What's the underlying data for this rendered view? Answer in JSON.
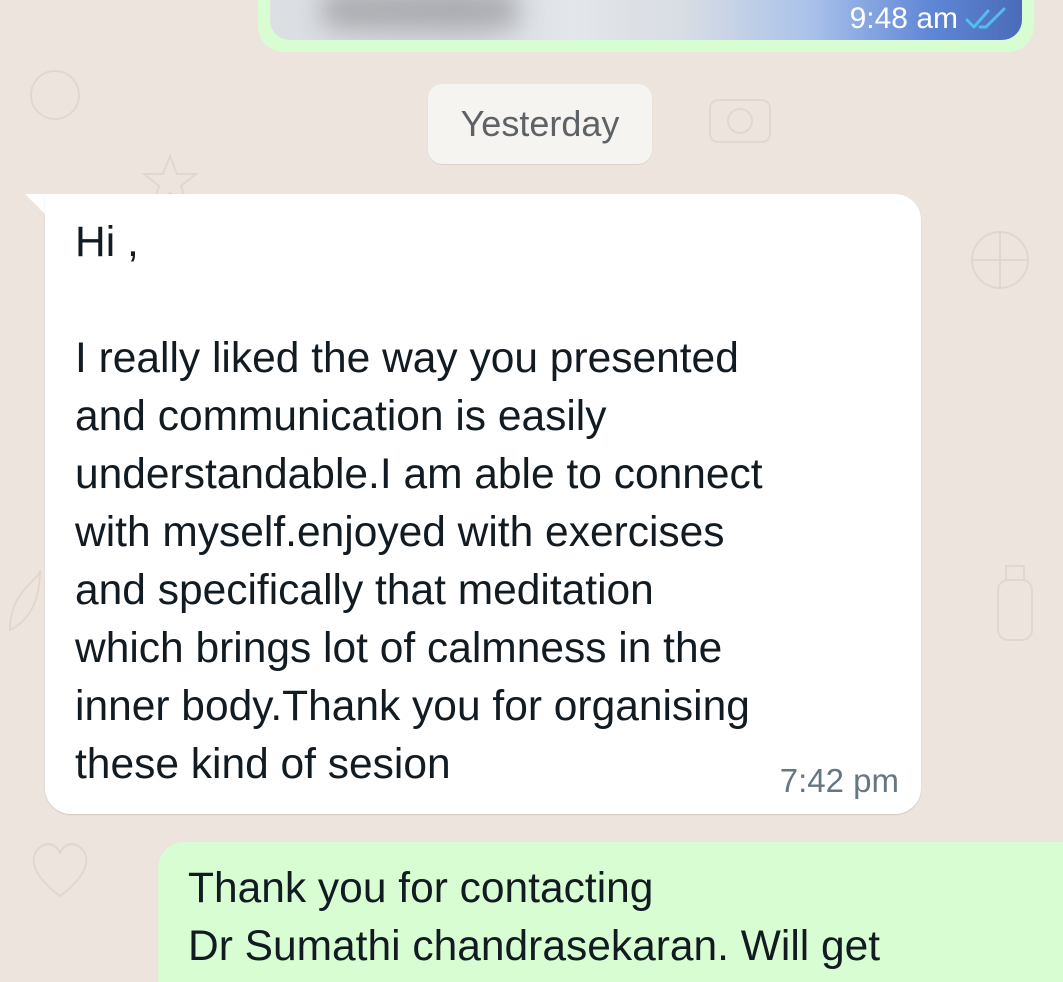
{
  "colors": {
    "wallpaper": "#ede5dd",
    "incoming_bubble": "#ffffff",
    "outgoing_bubble": "#d9fdd3",
    "read_ticks": "#53bdeb",
    "text": "#111b21",
    "timestamp": "#667781"
  },
  "top_message": {
    "type": "image",
    "time": "9:48 am",
    "status_icon": "double-check-read-icon"
  },
  "date_separator": {
    "label": "Yesterday"
  },
  "incoming_message": {
    "text": "Hi ,\n\nI really liked the way you presented\nand communication is easily\nunderstandable.I am able to connect\nwith myself.enjoyed with exercises\nand specifically that meditation\nwhich brings lot of calmness in the\ninner body.Thank you for organising\nthese kind of sesion",
    "time": "7:42 pm"
  },
  "outgoing_message": {
    "text": "Thank you for contacting\nDr Sumathi chandrasekaran. Will get"
  }
}
